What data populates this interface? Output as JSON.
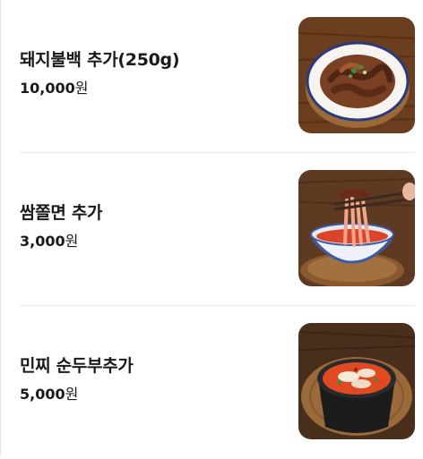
{
  "menu": {
    "items": [
      {
        "name": "돼지불백 추가(250g)",
        "price": "10,000",
        "currency": "원",
        "image_icon": "stir-fried-pork-plate"
      },
      {
        "name": "쌈쫄면 추가",
        "price": "3,000",
        "currency": "원",
        "image_icon": "noodle-bowl-chopsticks"
      },
      {
        "name": "민찌 순두부추가",
        "price": "5,000",
        "currency": "원",
        "image_icon": "soft-tofu-stew-pot"
      }
    ]
  }
}
